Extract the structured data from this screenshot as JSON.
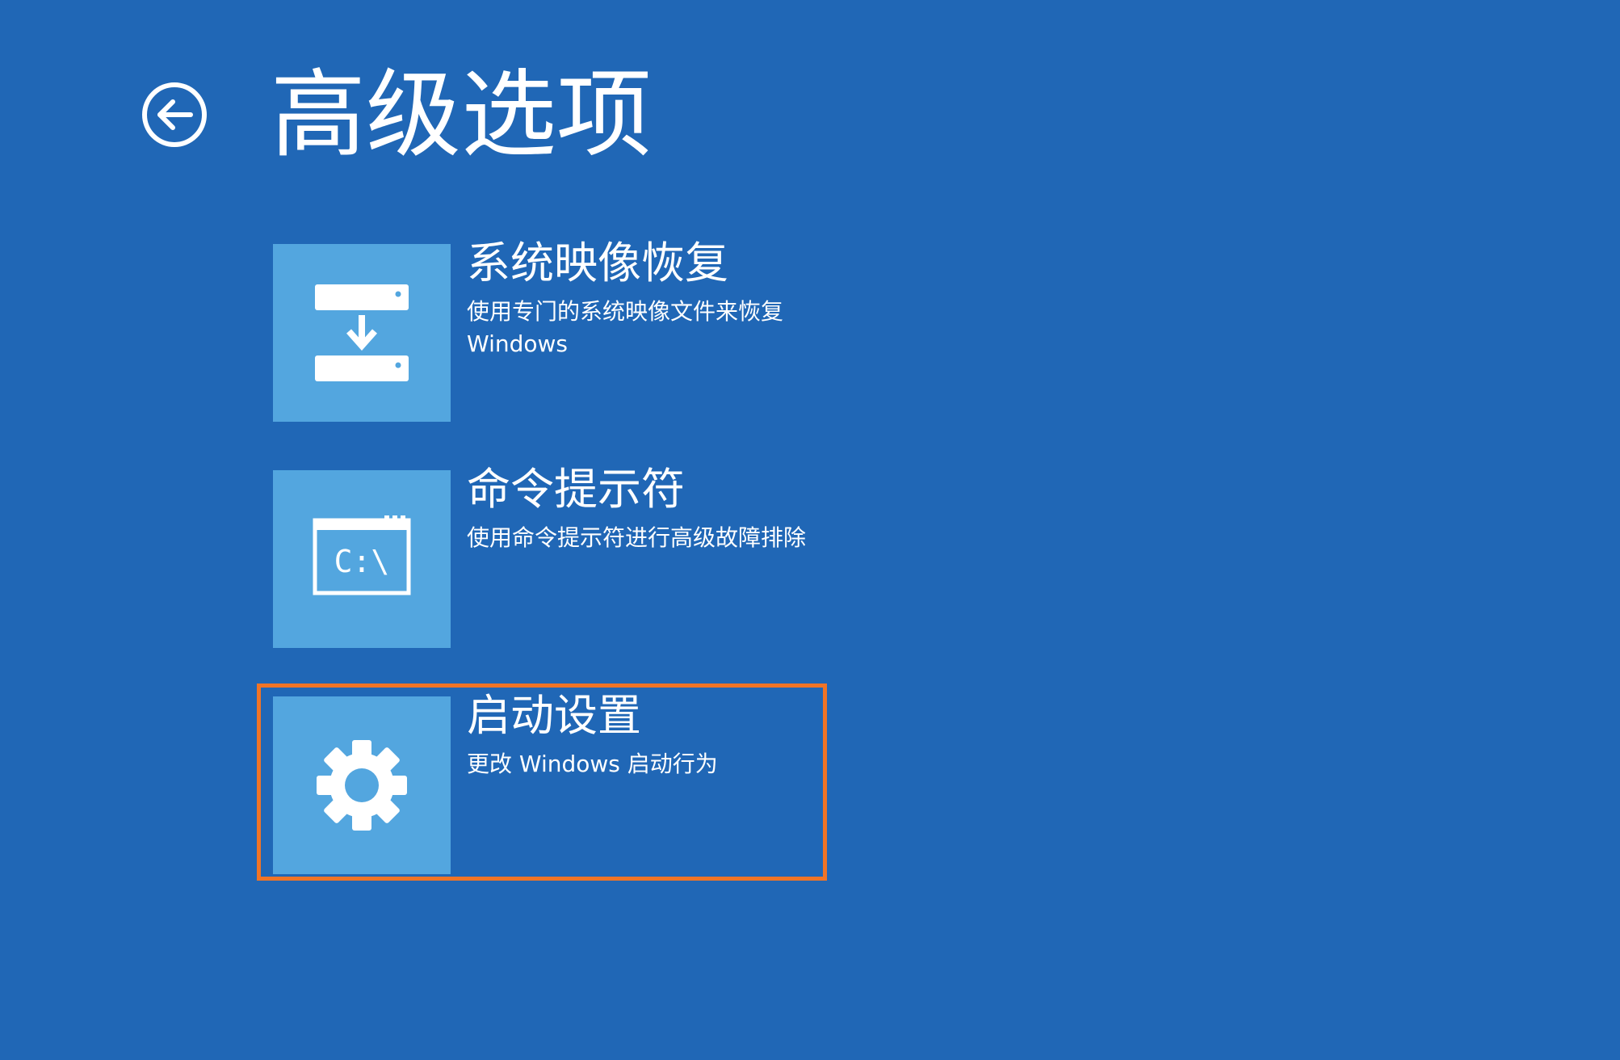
{
  "header": {
    "title": "高级选项",
    "back_icon": "back-arrow-circle-icon"
  },
  "options": [
    {
      "title": "系统映像恢复",
      "description": "使用专门的系统映像文件来恢复 Windows",
      "icon": "system-image-restore-icon"
    },
    {
      "title": "命令提示符",
      "description": "使用命令提示符进行高级故障排除",
      "icon": "command-prompt-icon",
      "icon_text": "C:\\"
    },
    {
      "title": "启动设置",
      "description": "更改 Windows 启动行为",
      "icon": "gear-icon"
    }
  ],
  "colors": {
    "background": "#2067b6",
    "tile": "#53a6df",
    "highlight": "#f07426",
    "text": "#ffffff"
  }
}
